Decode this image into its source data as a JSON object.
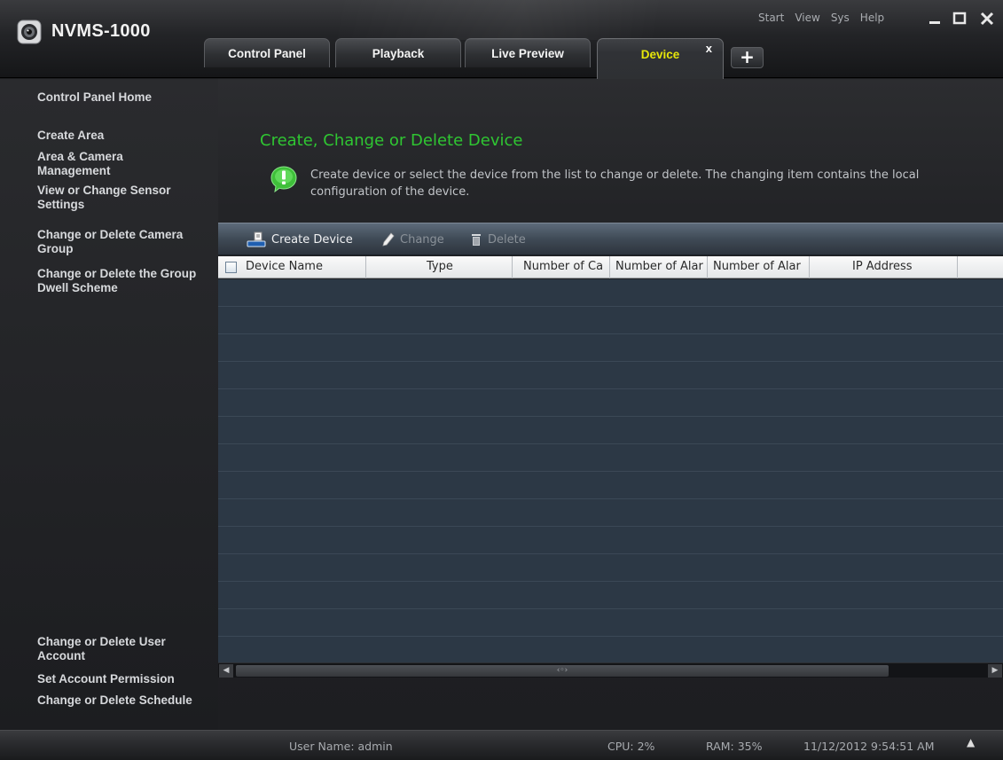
{
  "app": {
    "title": "NVMS-1000"
  },
  "top_menu": [
    "Start",
    "View",
    "Sys",
    "Help"
  ],
  "window_controls": {
    "minimize_icon": "minimize-icon",
    "maximize_icon": "maximize-icon",
    "close_icon": "close-icon"
  },
  "tabs": [
    {
      "label": "Control Panel",
      "active": false
    },
    {
      "label": "Playback",
      "active": false
    },
    {
      "label": "Live Preview",
      "active": false
    },
    {
      "label": "Device",
      "active": true,
      "close_glyph": "x"
    }
  ],
  "add_tab_glyph": "+",
  "sidebar": {
    "items": [
      {
        "label": "Control Panel Home"
      },
      {
        "label": "Create Area"
      },
      {
        "label": "Area & Camera Management"
      },
      {
        "label": "View or Change Sensor Settings"
      },
      {
        "label": "Change or Delete Camera Group"
      },
      {
        "label": "Change or Delete the Group Dwell Scheme"
      },
      {
        "label": "Change or Delete User Account"
      },
      {
        "label": "Set Account Permission"
      },
      {
        "label": "Change or Delete Schedule"
      }
    ]
  },
  "main": {
    "heading": "Create, Change or Delete Device",
    "info": "Create device or select the device from the list to change or delete. The changing item contains the local configuration of the device.",
    "toolbar": {
      "create_label": "Create Device",
      "change_label": "Change",
      "delete_label": "Delete"
    },
    "table": {
      "columns": [
        "Device Name",
        "Type",
        "Number of Ca",
        "Number of Alar",
        "Number of Alar",
        "IP Address",
        ""
      ],
      "rows": []
    },
    "scrollbar": {
      "thumb_glyph": "‹◦›"
    }
  },
  "status": {
    "user": "User Name: admin",
    "cpu": "CPU: 2%",
    "ram": "RAM: 35%",
    "datetime": "11/12/2012 9:54:51 AM",
    "up_glyph": "▲"
  },
  "colors": {
    "heading_green": "#2fc632",
    "active_tab_yellow": "#e6e60a",
    "table_body": "#2c3845",
    "toolbar_steel": "#4a5563"
  }
}
